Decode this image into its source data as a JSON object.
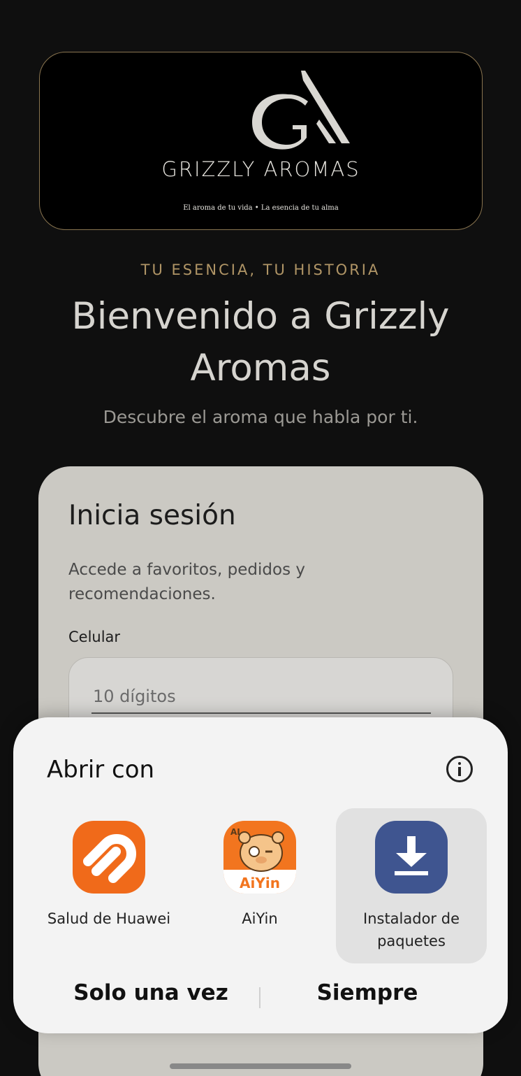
{
  "logo": {
    "name": "GRIZZLY AROMAS",
    "tagline": "El aroma de tu vida • La esencia de tu alma",
    "monogram": "GA"
  },
  "hero": {
    "eyebrow": "TU ESENCIA, TU HISTORIA",
    "headline": "Bienvenido a Grizzly Aromas",
    "subhead": "Descubre el aroma que habla por ti."
  },
  "login": {
    "title": "Inicia sesión",
    "description": "Accede a favoritos, pedidos y recomendaciones.",
    "phone_label": "Celular",
    "phone_placeholder": "10 dígitos"
  },
  "open_with_sheet": {
    "title": "Abrir con",
    "info_icon": "info-icon",
    "apps": [
      {
        "label": "Salud de Huawei",
        "icon": "huawei-health-icon",
        "color": "#f06a1a",
        "selected": false
      },
      {
        "label": "AiYin",
        "icon": "aiyin-icon",
        "color": "#f2751f",
        "selected": false
      },
      {
        "label": "Instalador de paquetes",
        "icon": "download-icon",
        "color": "#3f5590",
        "selected": true
      }
    ],
    "once_label": "Solo una vez",
    "always_label": "Siempre"
  },
  "colors": {
    "background": "#0f0f0f",
    "gold_accent": "#b09566",
    "card": "#cbc9c3",
    "sheet": "#f3f3f3"
  }
}
